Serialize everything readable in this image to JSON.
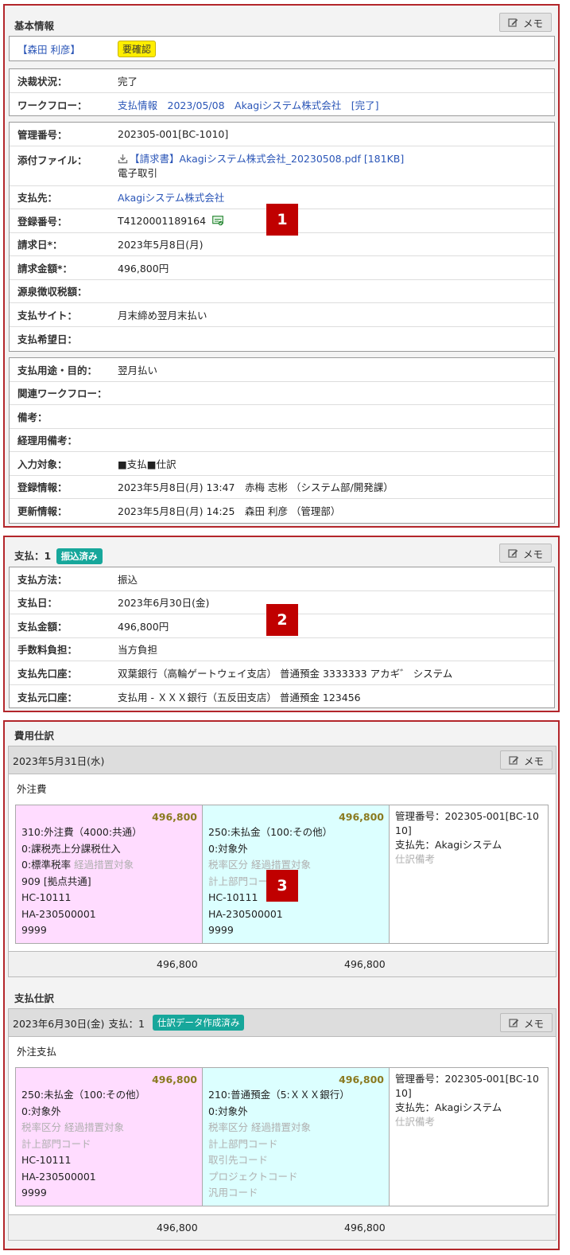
{
  "memo_label": "メモ",
  "basic": {
    "title": "基本情報",
    "person": "【森田 利彦】",
    "badge": "要確認",
    "approval": [
      {
        "label": "決裁状況：",
        "value": "完了"
      },
      {
        "label": "ワークフロー：",
        "value": "支払情報　2023/05/08　Akagiシステム株式会社　[完了]"
      }
    ],
    "details": {
      "mgmt_label": "管理番号：",
      "mgmt_value": "202305-001[BC-1010]",
      "file_label": "添付ファイル：",
      "file_link": "【請求書】Akagiシステム株式会社_20230508.pdf [181KB]",
      "file_note": "電子取引",
      "payee_label": "支払先：",
      "payee_value": "Akagiシステム株式会社",
      "regno_label": "登録番号：",
      "regno_value": "T4120001189164",
      "invdate_label": "請求日*：",
      "invdate_value": "2023年5月8日(月)",
      "invamt_label": "請求金額*：",
      "invamt_value": "496,800円",
      "wht_label": "源泉徴収税額：",
      "wht_value": "",
      "site_label": "支払サイト：",
      "site_value": "月末締め翌月末払い",
      "wish_label": "支払希望日：",
      "wish_value": ""
    },
    "meta": [
      {
        "label": "支払用途・目的：",
        "value": "翌月払い"
      },
      {
        "label": "関連ワークフロー：",
        "value": ""
      },
      {
        "label": "備考：",
        "value": ""
      },
      {
        "label": "経理用備考：",
        "value": ""
      },
      {
        "label": "入力対象：",
        "value": "■支払■仕訳"
      },
      {
        "label": "登録情報：",
        "value": "2023年5月8日(月) 13:47　赤梅 志彬 （システム部/開発課）"
      },
      {
        "label": "更新情報：",
        "value": "2023年5月8日(月) 14:25　森田 利彦 （管理部）"
      }
    ]
  },
  "payment": {
    "title": "支払：1",
    "badge": "振込済み",
    "rows": [
      {
        "label": "支払方法：",
        "value": "振込"
      },
      {
        "label": "支払日：",
        "value": "2023年6月30日(金)"
      },
      {
        "label": "支払金額：",
        "value": "496,800円"
      },
      {
        "label": "手数料負担：",
        "value": "当方負担"
      },
      {
        "label": "支払先口座：",
        "value": "双葉銀行（高輪ゲートウェイ支店） 普通預金 3333333 アカギ゛ システム"
      },
      {
        "label": "支払元口座：",
        "value": "支払用 - ＸＸＸ銀行（五反田支店） 普通預金 123456"
      }
    ]
  },
  "expense_journal": {
    "title": "費用仕訳",
    "date": "2023年5月31日(水)",
    "summary": "外注費",
    "debit": {
      "amount": "496,800",
      "account": "310:外注費（4000:共通）",
      "tax": "0:課税売上分課税仕入",
      "rate": "0:標準税率",
      "transition": "経過措置対象",
      "dept": "909 [拠点共通]",
      "hc": "HC-10111",
      "ha": "HA-230500001",
      "code": "9999"
    },
    "credit": {
      "amount": "496,800",
      "account": "250:未払金（100:その他）",
      "tax": "0:対象外",
      "rate": "税率区分",
      "transition": "経過措置対象",
      "dept": "計上部門コード",
      "hc": "HC-10111",
      "ha": "HA-230500001",
      "code": "9999"
    },
    "info": {
      "mgmt": "管理番号：202305-001[BC-1010]",
      "payee": "支払先：Akagiシステム",
      "note": "仕訳備考"
    },
    "total_debit": "496,800",
    "total_credit": "496,800"
  },
  "payment_journal": {
    "title": "支払仕訳",
    "date": "2023年6月30日(金)",
    "pay_no": "支払：1",
    "badge": "仕訳データ作成済み",
    "summary": "外注支払",
    "debit": {
      "amount": "496,800",
      "account": "250:未払金（100:その他）",
      "tax": "0:対象外",
      "rate": "税率区分",
      "transition": "経過措置対象",
      "dept": "計上部門コード",
      "hc": "HC-10111",
      "ha": "HA-230500001",
      "code": "9999"
    },
    "credit": {
      "amount": "496,800",
      "account": "210:普通預金（5:ＸＸＸ銀行）",
      "tax": "0:対象外",
      "rate": "税率区分",
      "transition": "経過措置対象",
      "dept": "計上部門コード",
      "partner": "取引先コード",
      "project": "プロジェクトコード",
      "general": "汎用コード"
    },
    "info": {
      "mgmt": "管理番号：202305-001[BC-1010]",
      "payee": "支払先：Akagiシステム",
      "note": "仕訳備考"
    },
    "total_debit": "496,800",
    "total_credit": "496,800"
  },
  "markers": [
    "1",
    "2",
    "3"
  ],
  "colors": {
    "frame": "#b3262b",
    "link": "#2a55b7",
    "debit_bg": "#ffdcff",
    "credit_bg": "#dcffff",
    "teal_badge": "#17a79b"
  }
}
